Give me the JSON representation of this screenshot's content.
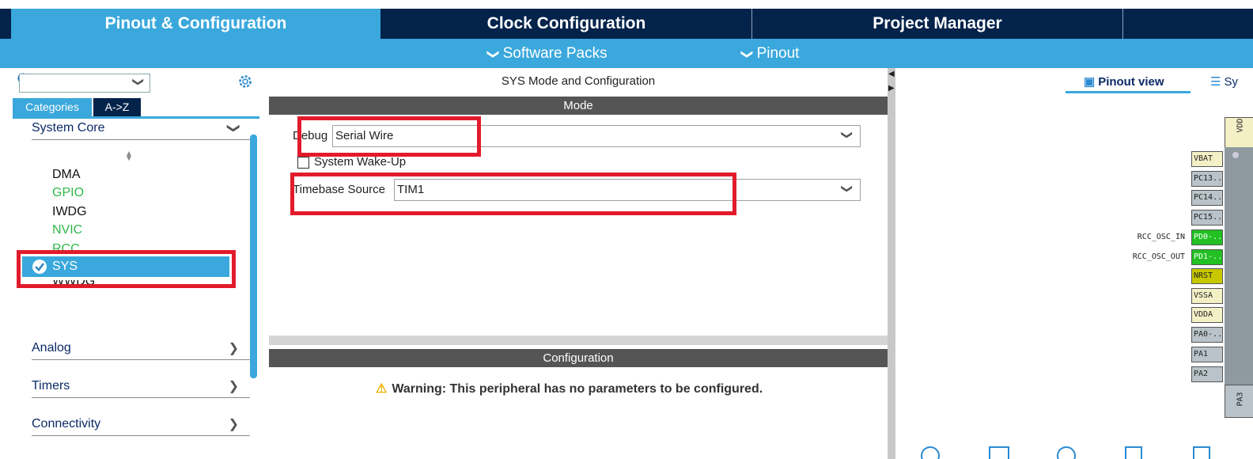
{
  "top_tabs": [
    "Pinout & Configuration",
    "Clock Configuration",
    "Project Manager"
  ],
  "sub_bar": {
    "software_packs": "Software Packs",
    "pinout": "Pinout"
  },
  "left": {
    "search_value": "",
    "tabs": {
      "categories": "Categories",
      "az": "A->Z"
    },
    "groups": {
      "system_core": "System Core",
      "analog": "Analog",
      "timers": "Timers",
      "connectivity": "Connectivity"
    },
    "peripherals": [
      "DMA",
      "GPIO",
      "IWDG",
      "NVIC",
      "RCC",
      "SYS",
      "WWDG"
    ],
    "selected": "SYS"
  },
  "middle": {
    "title": "SYS Mode and Configuration",
    "mode_header": "Mode",
    "debug_label": "Debug",
    "debug_value": "Serial Wire",
    "wakeup_label": "System Wake-Up",
    "timebase_label": "Timebase Source",
    "timebase_value": "TIM1",
    "config_header": "Configuration",
    "warning": "Warning: This peripheral has no parameters to be configured."
  },
  "right": {
    "pinout_view": "Pinout view",
    "system_view": "Sy",
    "top_pin": "VDD",
    "bottom_pin": "PA3",
    "pins": [
      "VBAT",
      "PC13..",
      "PC14..",
      "PC15..",
      "PD0-..",
      "PD1-..",
      "NRST",
      "VSSA",
      "VDDA",
      "PA0-..",
      "PA1",
      "PA2"
    ],
    "pin_labels": {
      "osc_in": "RCC_OSC_IN",
      "osc_out": "RCC_OSC_OUT"
    }
  },
  "colors": {
    "navy": "#03234b",
    "accent_blue": "#3aa8dc",
    "highlight_red": "#e21b2c",
    "pin_green": "#22c022",
    "pin_yellow": "#c8c800",
    "pin_grey": "#b9c3c9",
    "pin_beige": "#f4f0c6",
    "gpio_green": "#2fb84a"
  }
}
